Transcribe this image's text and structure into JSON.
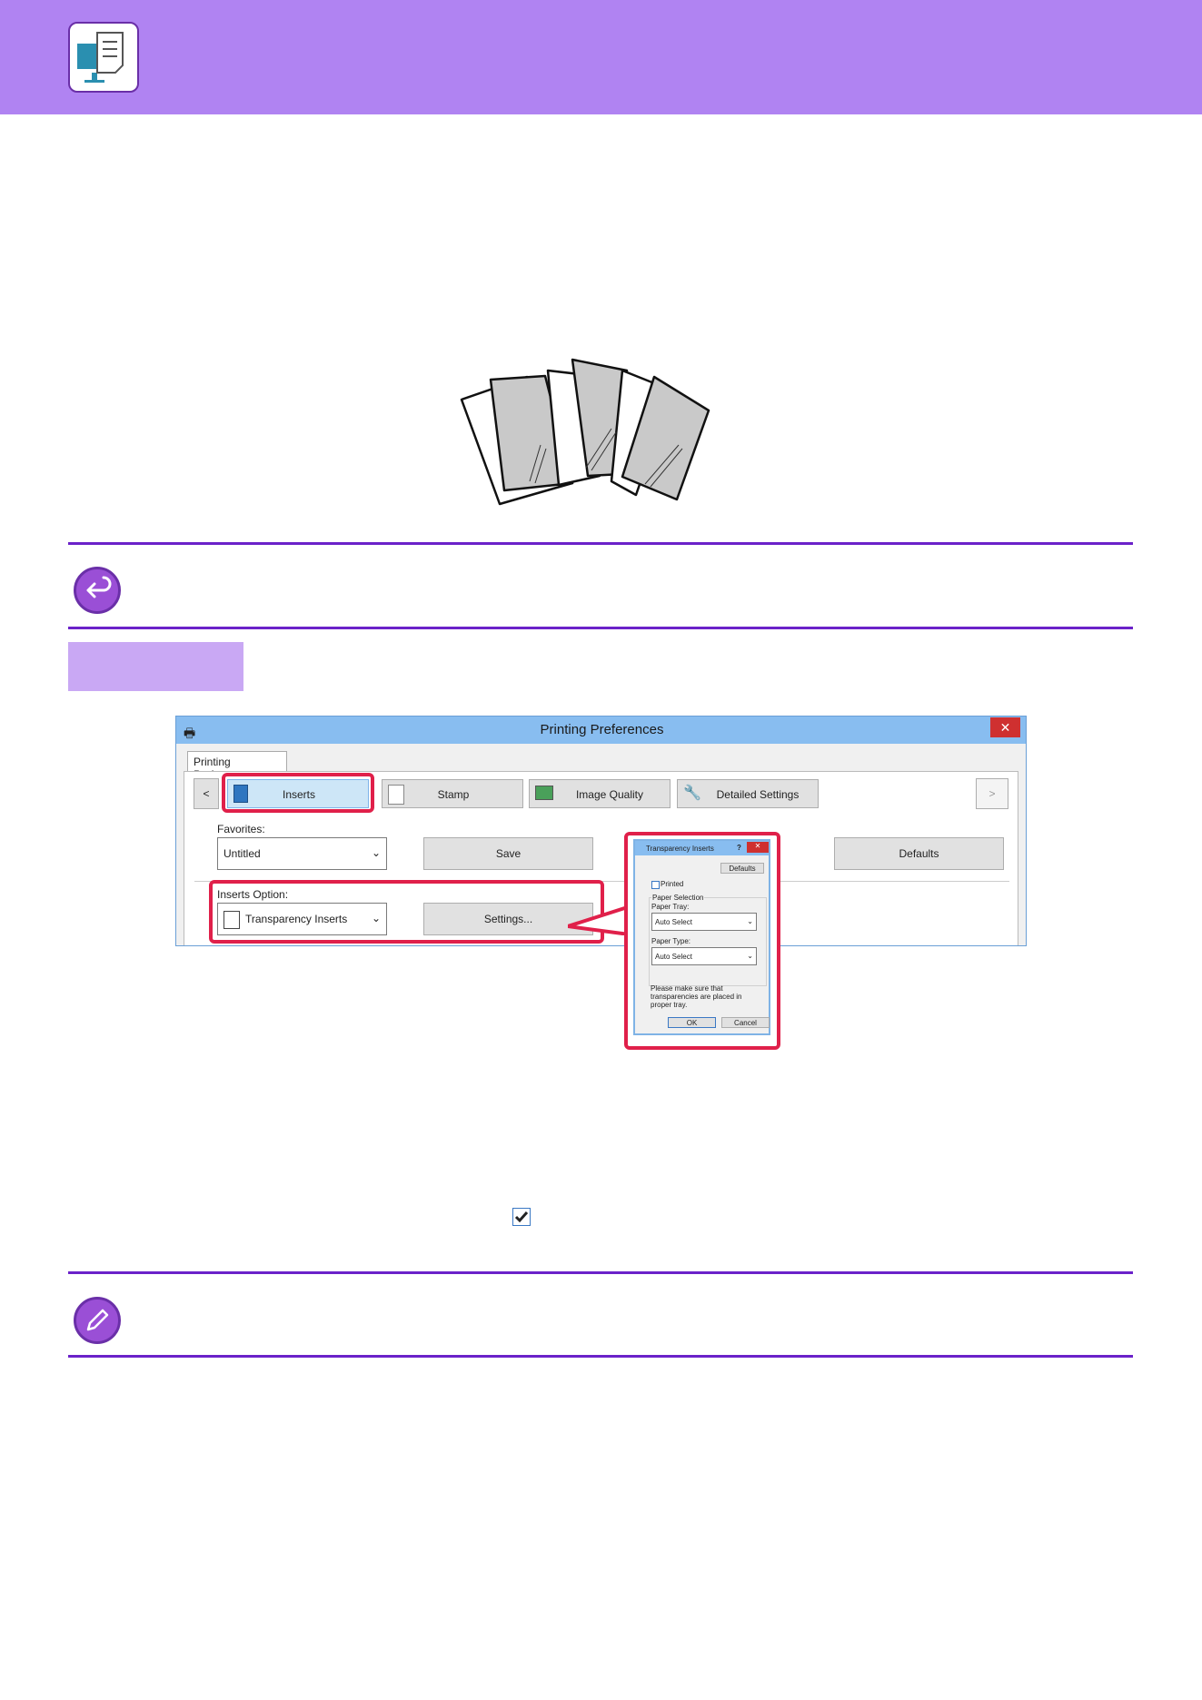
{
  "dialog": {
    "title": "Printing Preferences",
    "close_glyph": "✕",
    "tab_label": "Printing Preferences",
    "nav_prev": "<",
    "nav_next": ">",
    "tabs": [
      "Inserts",
      "Stamp",
      "Image Quality",
      "Detailed Settings"
    ],
    "favorites_label": "Favorites:",
    "favorites_value": "Untitled",
    "save_label": "Save",
    "defaults_label": "Defaults",
    "inserts_option_label": "Inserts Option:",
    "inserts_option_value": "Transparency Inserts",
    "settings_label": "Settings..."
  },
  "subdialog": {
    "title": "Transparency Inserts",
    "help_glyph": "?",
    "close_glyph": "✕",
    "defaults_label": "Defaults",
    "printed_label": "Printed",
    "paper_selection_label": "Paper Selection",
    "paper_tray_label": "Paper Tray:",
    "paper_tray_value": "Auto Select",
    "paper_type_label": "Paper Type:",
    "paper_type_value": "Auto Select",
    "note": "Please make sure that transparencies are placed in proper tray.",
    "ok_label": "OK",
    "cancel_label": "Cancel"
  },
  "colors": {
    "header": "#b083f2",
    "rule": "#6b22c9",
    "highlight": "#e0204a"
  }
}
